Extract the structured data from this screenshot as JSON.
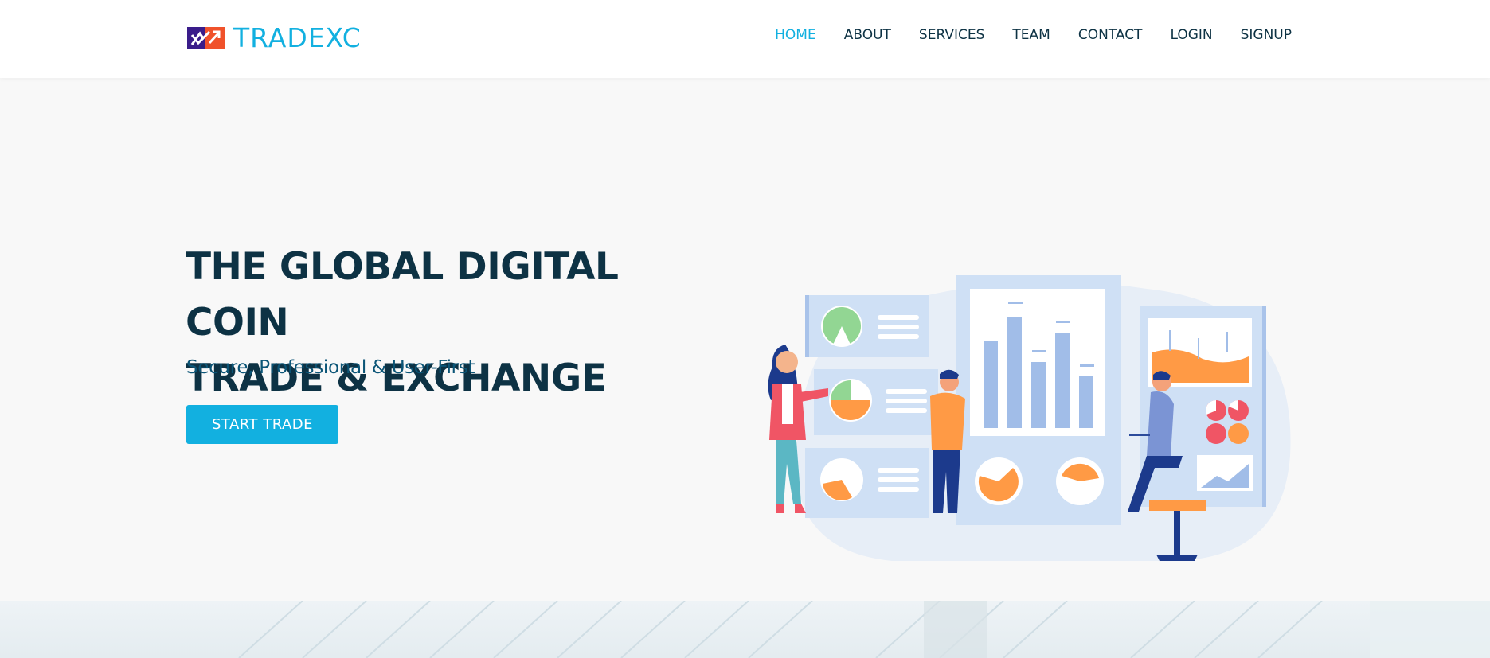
{
  "brand": {
    "name": "TRADEXC",
    "accent_color": "#12b0e0",
    "text_dark": "#0d3244",
    "logo_colors": [
      "#3a1d8a",
      "#f0522b"
    ]
  },
  "nav": {
    "items": [
      {
        "label": "HOME",
        "active": true
      },
      {
        "label": "ABOUT",
        "active": false
      },
      {
        "label": "SERVICES",
        "active": false
      },
      {
        "label": "TEAM",
        "active": false
      },
      {
        "label": "CONTACT",
        "active": false
      },
      {
        "label": "LOGIN",
        "active": false
      },
      {
        "label": "SIGNUP",
        "active": false
      }
    ]
  },
  "hero": {
    "title_line1": "THE GLOBAL DIGITAL COIN",
    "title_line2": "TRADE & EXCHANGE",
    "subtitle": "Secure, Professional & User-First",
    "cta_label": "START TRADE"
  },
  "illustration": {
    "icon": "business-analytics-illustration",
    "colors": [
      "#cfe0f5",
      "#a1bde8",
      "#ff9a45",
      "#92d693",
      "#f05565",
      "#1c3a8c"
    ]
  }
}
